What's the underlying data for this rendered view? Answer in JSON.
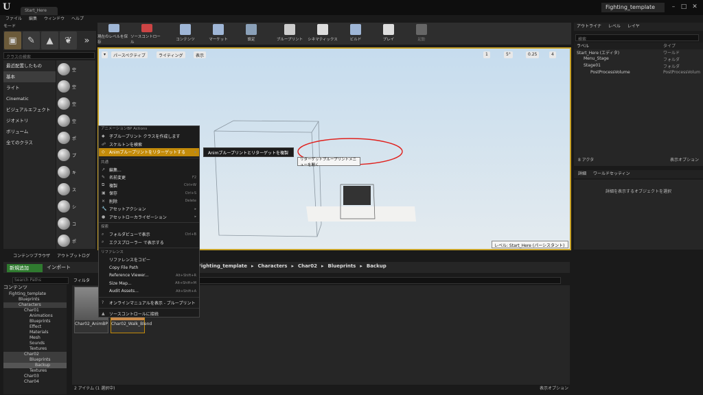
{
  "title": {
    "doc_tab": "Start_Here",
    "project": "Fighting_template",
    "logo": "U"
  },
  "menu": [
    "ファイル",
    "編集",
    "ウィンドウ",
    "ヘルプ"
  ],
  "modes": {
    "tab": "モード",
    "search_placeholder": "クラスの検索",
    "categories": [
      "最近配置したもの",
      "基本",
      "ライト",
      "Cinematic",
      "ビジュアルエフェクト",
      "ジオメトリ",
      "ボリューム",
      "全てのクラス"
    ],
    "items": [
      "空",
      "空",
      "空",
      "空",
      "ポ",
      "プ",
      "キ",
      "ス",
      "シ",
      "コ",
      "ポ",
      "ポ"
    ]
  },
  "toolbar": [
    "現在のレベルを保存",
    "ソースコントロール",
    "コンテンツ",
    "マーケット",
    "設定",
    "ブループリント",
    "シネマティックス",
    "ビルド",
    "プレイ",
    "起動"
  ],
  "viewport": {
    "perspective": "パースペクティブ",
    "lighting": "ライティング",
    "show": "表示",
    "grid": "1",
    "angle": "5°",
    "scale": "0.25",
    "cam": "4",
    "level_label": "レベル: Start_Here (パーシスタント)"
  },
  "outliner": {
    "tabs": [
      "アウトライナ",
      "レベル",
      "レイヤ"
    ],
    "search_placeholder": "検索",
    "col_label": "ラベル",
    "col_type": "タイプ",
    "rows": [
      {
        "name": "Start_Here (エディタ)",
        "type": "ワールド"
      },
      {
        "name": "Menu_Stage",
        "type": "フォルダ"
      },
      {
        "name": "Stage01",
        "type": "フォルダ"
      },
      {
        "name": "PostProcessVolume",
        "type": "PostProcessVolum"
      }
    ],
    "count": "8 アクタ",
    "view_options": "表示オプション"
  },
  "details": {
    "tabs": [
      "詳細",
      "ワールドセッティン"
    ],
    "placeholder": "詳細を表示するオブジェクトを選択"
  },
  "content_browser": {
    "tabs": [
      "コンテンツブラウザ",
      "アウトプットログ"
    ],
    "add_new": "新規追加",
    "import": "インポート",
    "breadcrumb": [
      "Fighting_template",
      "Characters",
      "Char02",
      "Blueprints",
      "Backup"
    ],
    "search_paths": "Search Paths",
    "filter": "フィルタ",
    "tree": [
      "コンテンツ",
      "Fighting_template",
      "Blueprints",
      "Characters",
      "Char01",
      "Animations",
      "Blueprints",
      "Effect",
      "Materials",
      "Mesh",
      "Sounds",
      "Textures",
      "Char02",
      "Blueprints",
      "Backup",
      "Textures",
      "Char03",
      "Char04"
    ],
    "assets": [
      "Char02_AnimBP",
      "Char02_Walk_Blend"
    ],
    "status": "2 アイテム (1 選択中)",
    "view_options": "表示オプション"
  },
  "context_menu": {
    "sections": [
      "アニメーションBP Actions",
      "共通",
      "探索",
      "リファレンス"
    ],
    "items": [
      {
        "label": "子ブループリント クラスを作成します",
        "shortcut": ""
      },
      {
        "label": "スケルトンを検索",
        "shortcut": ""
      },
      {
        "label": "Animブループリントをリターゲットする",
        "shortcut": ""
      },
      {
        "label": "編集...",
        "shortcut": ""
      },
      {
        "label": "名前変更",
        "shortcut": "F2"
      },
      {
        "label": "複製",
        "shortcut": "Ctrl+W"
      },
      {
        "label": "保存",
        "shortcut": "Ctrl+S"
      },
      {
        "label": "削除",
        "shortcut": "Delete"
      },
      {
        "label": "アセットアクション",
        "shortcut": ""
      },
      {
        "label": "アセットローカライゼーション",
        "shortcut": ""
      },
      {
        "label": "フォルダビューで表示",
        "shortcut": "Ctrl+B"
      },
      {
        "label": "エクスプローラー で表示する",
        "shortcut": ""
      },
      {
        "label": "リファレンスをコピー",
        "shortcut": ""
      },
      {
        "label": "Copy File Path",
        "shortcut": ""
      },
      {
        "label": "Reference Viewer...",
        "shortcut": "Alt+Shift+R"
      },
      {
        "label": "Size Map...",
        "shortcut": "Alt+Shift+M"
      },
      {
        "label": "Audit Assets...",
        "shortcut": "Alt+Shift+A"
      },
      {
        "label": "オンラインマニュアルを表示 - ブループリント",
        "shortcut": ""
      },
      {
        "label": "ソースコントロールに接続",
        "shortcut": ""
      }
    ],
    "submenu": "Animブループリントとリターゲットを複製",
    "tooltip": "リターゲットブループリントメニューを開く"
  },
  "colors": {
    "highlight": "#c38b0a",
    "add_button": "#2f7a2f",
    "annotation": "#e0201c"
  }
}
